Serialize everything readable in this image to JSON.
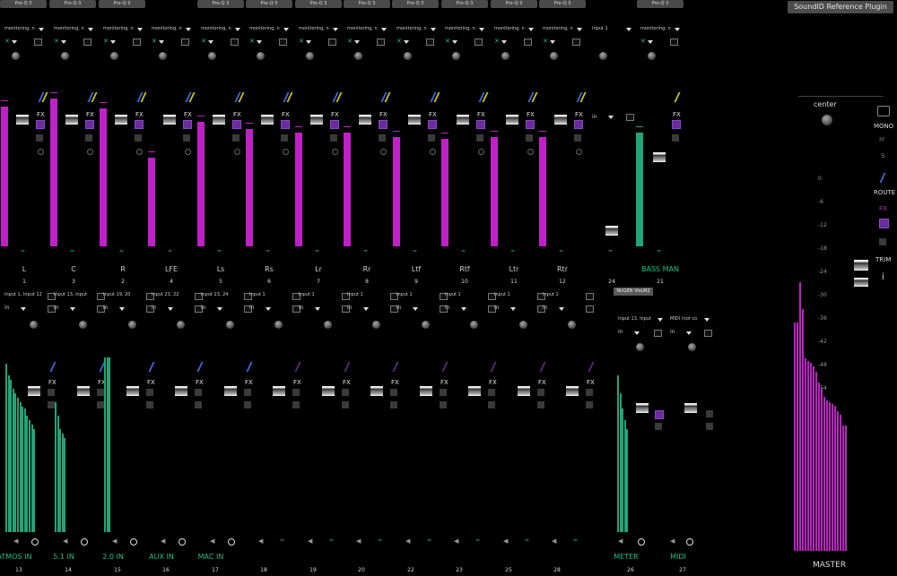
{
  "window": {
    "plugin_button": "SoundID Reference Plugin"
  },
  "top_strip": {
    "plugins": [
      "Pro-Q 3",
      "Pro-Q 3",
      "Pro-Q 3",
      "Pro-Q 3",
      "Pro-Q 3",
      "Pro-Q 3",
      "Pro-Q 3",
      "Pro-Q 3",
      "Pro-Q 3",
      "Pro-Q 3",
      "Pro-Q 3",
      "Pro-Q 3"
    ],
    "bass_plugin": "Pro-Q 3",
    "input_labels": [
      "monitoring, n",
      "monitoring, n",
      "monitoring, n",
      "monitoring, n",
      "monitoring, n",
      "monitoring, n",
      "monitoring, n",
      "monitoring, n",
      "monitoring, n",
      "monitoring, n",
      "monitoring, n",
      "monitoring, n",
      "Input 1",
      "monitoring, n"
    ],
    "in_label": "in",
    "channels": [
      {
        "name": "L",
        "num": "1",
        "level": 0.82
      },
      {
        "name": "C",
        "num": "3",
        "level": 0.87
      },
      {
        "name": "R",
        "num": "2",
        "level": 0.81
      },
      {
        "name": "LFE",
        "num": "4",
        "level": 0.52
      },
      {
        "name": "Ls",
        "num": "5",
        "level": 0.73
      },
      {
        "name": "Rs",
        "num": "6",
        "level": 0.69
      },
      {
        "name": "Lr",
        "num": "7",
        "level": 0.67
      },
      {
        "name": "Rr",
        "num": "8",
        "level": 0.67
      },
      {
        "name": "Ltf",
        "num": "9",
        "level": 0.64
      },
      {
        "name": "Rtf",
        "num": "10",
        "level": 0.63
      },
      {
        "name": "Ltr",
        "num": "11",
        "level": 0.64
      },
      {
        "name": "Rtr",
        "num": "12",
        "level": 0.64
      },
      {
        "name": "",
        "num": "24",
        "level": 0
      },
      {
        "name": "BASS MAN",
        "num": "21",
        "level": 0.67
      }
    ],
    "nugen_button": "NUGEN VisLM2",
    "fx_label": "FX"
  },
  "bottom_strip": {
    "input_labels": [
      "Input 1, Input 12",
      "Input 13, Input",
      "Input 19, 20",
      "Input 21, 22",
      "Input 23, 24",
      "Input 1",
      "Input 1",
      "Input 1",
      "Input 1",
      "Input 1",
      "Input 1",
      "Input 1"
    ],
    "channels": [
      {
        "name": "ATMOS IN",
        "num": "13"
      },
      {
        "name": "5.1 IN",
        "num": "14"
      },
      {
        "name": "2.0 IN",
        "num": "15"
      },
      {
        "name": "AUX IN",
        "num": "16"
      },
      {
        "name": "MAC IN",
        "num": "17"
      },
      {
        "name": "",
        "num": "18"
      },
      {
        "name": "",
        "num": "19"
      },
      {
        "name": "",
        "num": "20"
      },
      {
        "name": "",
        "num": "22"
      },
      {
        "name": "",
        "num": "23"
      },
      {
        "name": "",
        "num": "25"
      },
      {
        "name": "",
        "num": "28"
      },
      {
        "name": "METER",
        "num": "26"
      },
      {
        "name": "MIDI",
        "num": "27"
      }
    ],
    "meter_input": "Input 13, Input",
    "midi_input": "MIDI (not co"
  },
  "master": {
    "name": "MASTER",
    "pan_label": "center",
    "side_labels": {
      "mono": "MONO",
      "route": "ROUTE",
      "fx": "FX",
      "trim": "TRIM",
      "info": "i",
      "solo": "S"
    },
    "scale": [
      "0",
      "-6",
      "-12",
      "-18",
      "-24",
      "-30",
      "-36",
      "-42",
      "-48",
      "-54"
    ]
  },
  "colors": {
    "magenta": "#c020c8",
    "teal": "#1fa578",
    "bg": "#000000",
    "label_teal": "#1fbf8a"
  }
}
